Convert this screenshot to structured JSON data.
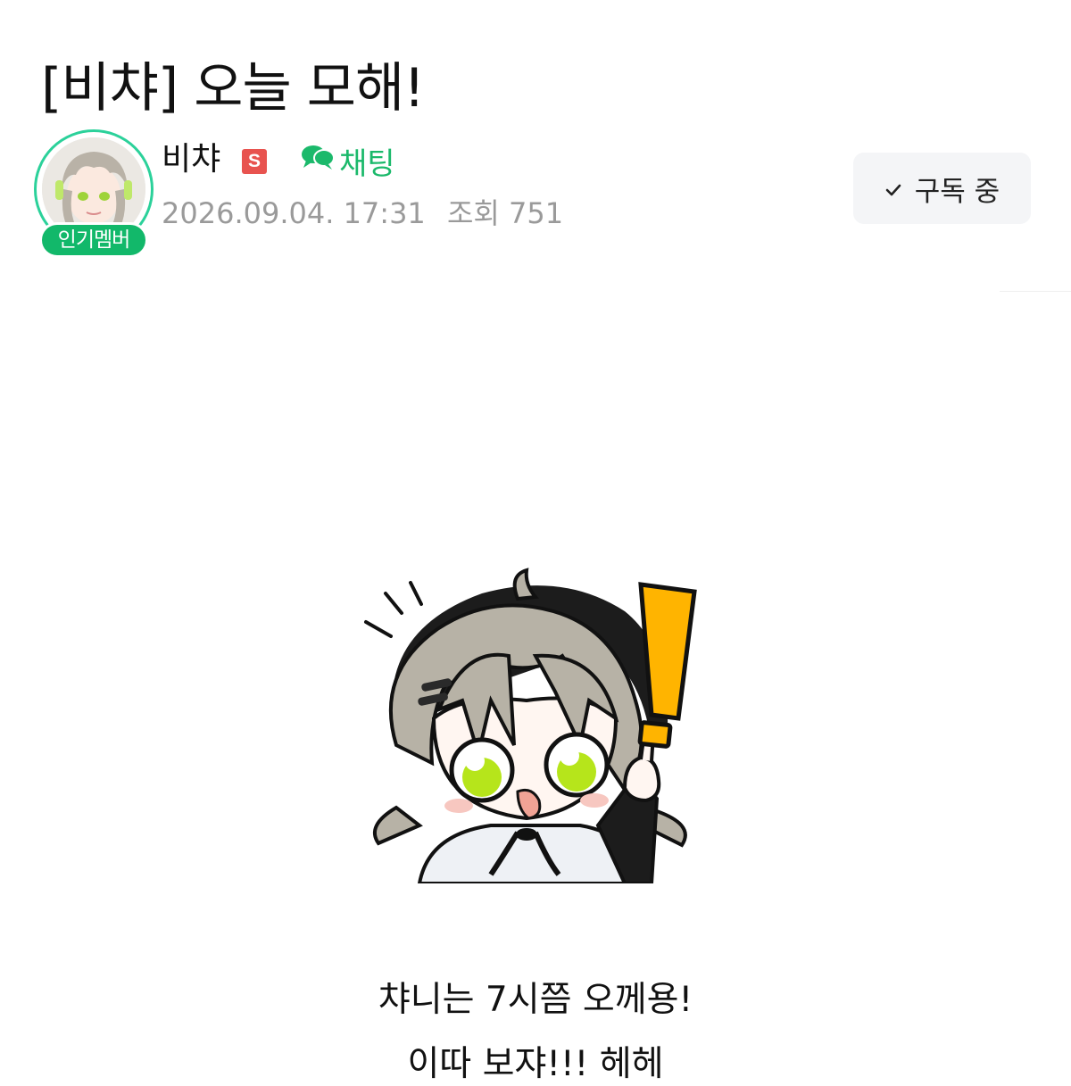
{
  "post": {
    "title": "[비챠] 오늘 모해!",
    "body_lines": [
      "챠니는 7시쯤 오께용!",
      "이따 보쟈!!! 헤헤"
    ]
  },
  "author": {
    "name": "비챠",
    "avatar_icon": "avatar-anime-girl",
    "rank_badge": "인기멤버",
    "level_badge": "S",
    "chat_label": "채팅",
    "date": "2026.09.04. 17:31",
    "views_label": "조회",
    "views": "751"
  },
  "subscribe": {
    "label": "구독 중",
    "icon": "check-icon"
  },
  "sticker": {
    "icon": "chibi-girl-exclamation-sticker"
  },
  "colors": {
    "accent_green": "#1bb96b",
    "badge_green": "#12b86a",
    "ring_mint": "#2bd19a",
    "s_badge_red": "#e8534f",
    "meta_gray": "#9a9a9a",
    "button_bg": "#f4f5f7",
    "exclamation_yellow": "#ffb400"
  }
}
